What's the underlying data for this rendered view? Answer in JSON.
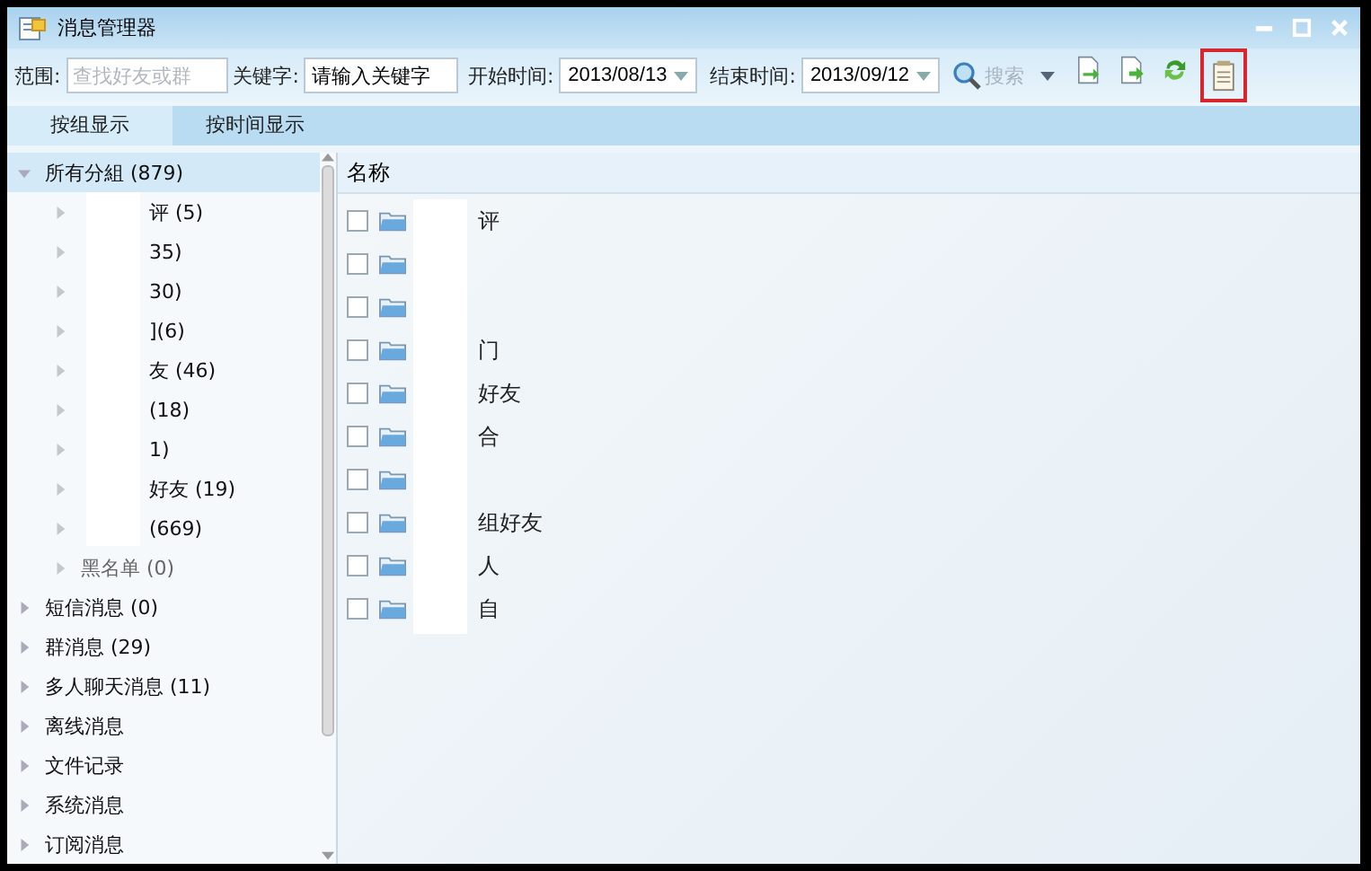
{
  "window": {
    "title": "消息管理器"
  },
  "toolbar": {
    "scope": {
      "label": "范围:",
      "placeholder": "查找好友或群"
    },
    "keyword": {
      "label": "关键字:",
      "value": "请输入关键字"
    },
    "start": {
      "label": "开始时间:",
      "value": "2013/08/13"
    },
    "end": {
      "label": "结束时间:",
      "value": "2013/09/12"
    },
    "search": {
      "label": "搜索",
      "disabled": true
    },
    "tools": [
      {
        "kind": "import",
        "highlighted": false
      },
      {
        "kind": "export",
        "highlighted": false
      },
      {
        "kind": "refresh",
        "highlighted": false
      },
      {
        "kind": "notes",
        "highlighted": true
      }
    ]
  },
  "tabs": [
    {
      "label": "按组显示",
      "selected": true
    },
    {
      "label": "按时间显示",
      "selected": false
    }
  ],
  "tree": [
    {
      "label": "所有分組 (879)",
      "expanded": true,
      "selected": true,
      "children": [
        {
          "label": "评 (5)",
          "redacted": true
        },
        {
          "label": "35)",
          "redacted": true
        },
        {
          "label": "30)",
          "redacted": true
        },
        {
          "label": "](6)",
          "redacted": true
        },
        {
          "label": "友 (46)",
          "redacted": true
        },
        {
          "label": "(18)",
          "redacted": true
        },
        {
          "label": "1)",
          "redacted": true
        },
        {
          "label": "好友 (19)",
          "redacted": true
        },
        {
          "label": "(669)",
          "redacted": true
        },
        {
          "label": "黑名单 (0)",
          "redacted": false
        }
      ]
    },
    {
      "label": "短信消息 (0)",
      "expanded": false,
      "selected": false
    },
    {
      "label": "群消息 (29)",
      "expanded": false,
      "selected": false
    },
    {
      "label": "多人聊天消息 (11)",
      "expanded": false,
      "selected": false
    },
    {
      "label": "离线消息",
      "expanded": false,
      "selected": false
    },
    {
      "label": "文件记录",
      "expanded": false,
      "selected": false
    },
    {
      "label": "系统消息",
      "expanded": false,
      "selected": false
    },
    {
      "label": "订阅消息",
      "expanded": false,
      "selected": false
    }
  ],
  "list": {
    "column": "名称",
    "rows": [
      {
        "label": "评",
        "checked": false
      },
      {
        "checked": false
      },
      {
        "checked": false
      },
      {
        "label": "门",
        "checked": false
      },
      {
        "label": "好友",
        "checked": false
      },
      {
        "label": "合",
        "checked": false
      },
      {
        "checked": false
      },
      {
        "label": "组好友",
        "checked": false
      },
      {
        "label": "人",
        "checked": false
      },
      {
        "label": "自",
        "checked": false
      }
    ]
  }
}
